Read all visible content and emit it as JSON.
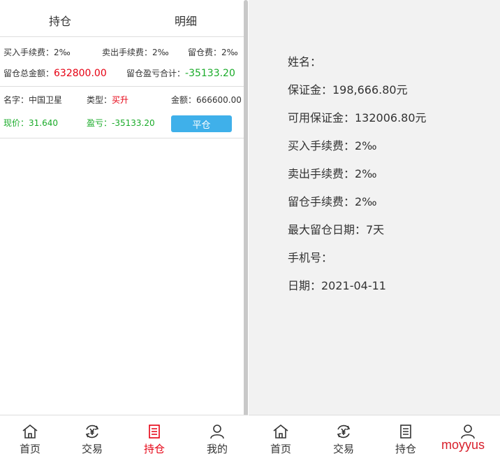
{
  "tabs": {
    "positions": "持仓",
    "details": "明细"
  },
  "fees": {
    "buy_fee": "买入手续费：2‰",
    "sell_fee": "卖出手续费：2‰",
    "hold_fee": "留仓费：2‰"
  },
  "summary": {
    "total_label": "留仓总金额：",
    "total_value": "632800.00",
    "pl_label": "留仓盈亏合计：",
    "pl_value": "-35133.20"
  },
  "position": {
    "name": "名字：中国卫星",
    "type_label": "类型：",
    "type_value": "买升",
    "amount": "金额：666600.00",
    "price": "现价：31.640",
    "pl": "盈亏：-35133.20",
    "close_label": "平仓"
  },
  "account": {
    "name": "姓名：",
    "margin": "保证金：198,666.80元",
    "available_margin": "可用保证金：132006.80元",
    "buy_fee": "买入手续费：2‰",
    "sell_fee": "卖出手续费：2‰",
    "hold_fee": "留仓手续费：2‰",
    "max_days": "最大留仓日期：7天",
    "phone": "手机号：",
    "date": "日期：2021-04-11"
  },
  "tabbar": {
    "home": "首页",
    "trade": "交易",
    "hold": "持仓",
    "mine": "我的"
  },
  "tabbar_right": {
    "home": "首页",
    "trade": "交易",
    "hold": "持仓"
  },
  "watermark": "moyyus",
  "colors": {
    "accent_red": "#e60012",
    "profit_green": "#1aab29",
    "button_blue": "#3fb0ea"
  },
  "icons": [
    "home-icon",
    "yen-cycle-icon",
    "document-icon",
    "user-icon"
  ]
}
